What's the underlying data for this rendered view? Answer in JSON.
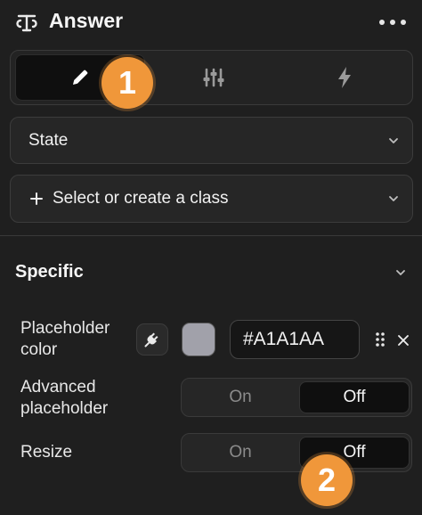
{
  "panel": {
    "title": "Answer",
    "more_icon": "more-horizontal-icon"
  },
  "tabs": [
    {
      "icon": "pencil-icon",
      "active": true
    },
    {
      "icon": "sliders-icon",
      "active": false
    },
    {
      "icon": "lightning-icon",
      "active": false
    }
  ],
  "state_dropdown": {
    "label": "State"
  },
  "class_dropdown": {
    "label": "Select or create a class"
  },
  "section": {
    "title": "Specific"
  },
  "properties": {
    "placeholder_color": {
      "label": "Placeholder color",
      "value": "#A1A1AA",
      "swatch": "#A1A1AA"
    },
    "advanced_placeholder": {
      "label": "Advanced placeholder",
      "on_label": "On",
      "off_label": "Off",
      "selected": "Off"
    },
    "resize": {
      "label": "Resize",
      "on_label": "On",
      "off_label": "Off",
      "selected": "Off"
    }
  },
  "annotations": [
    {
      "label": "1"
    },
    {
      "label": "2"
    }
  ],
  "colors": {
    "badge": "#F0973A",
    "background": "#1F1F1F"
  }
}
